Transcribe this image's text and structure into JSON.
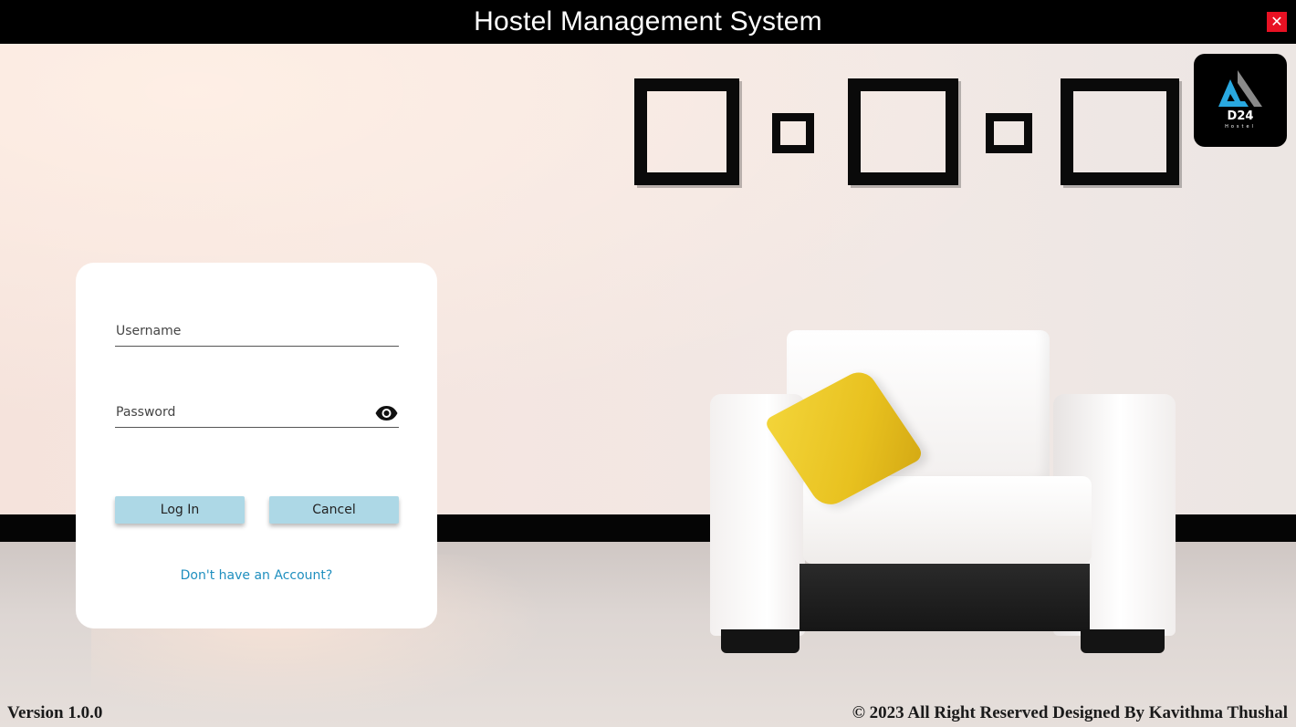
{
  "window": {
    "title": "Hostel Management System",
    "close_label": "✕"
  },
  "logo": {
    "text": "D24",
    "subtext": "Hostel",
    "accent_color": "#29a8e0"
  },
  "login": {
    "username_placeholder": "Username",
    "password_placeholder": "Password",
    "login_button": "Log In",
    "cancel_button": "Cancel",
    "signup_link": "Don't have an Account?"
  },
  "footer": {
    "version": "Version 1.0.0",
    "copyright": "© 2023 All Right Reserved Designed By Kavithma Thushal"
  },
  "colors": {
    "button_bg": "#add8e6",
    "link": "#1f8fbf",
    "close_bg": "#e81123"
  }
}
